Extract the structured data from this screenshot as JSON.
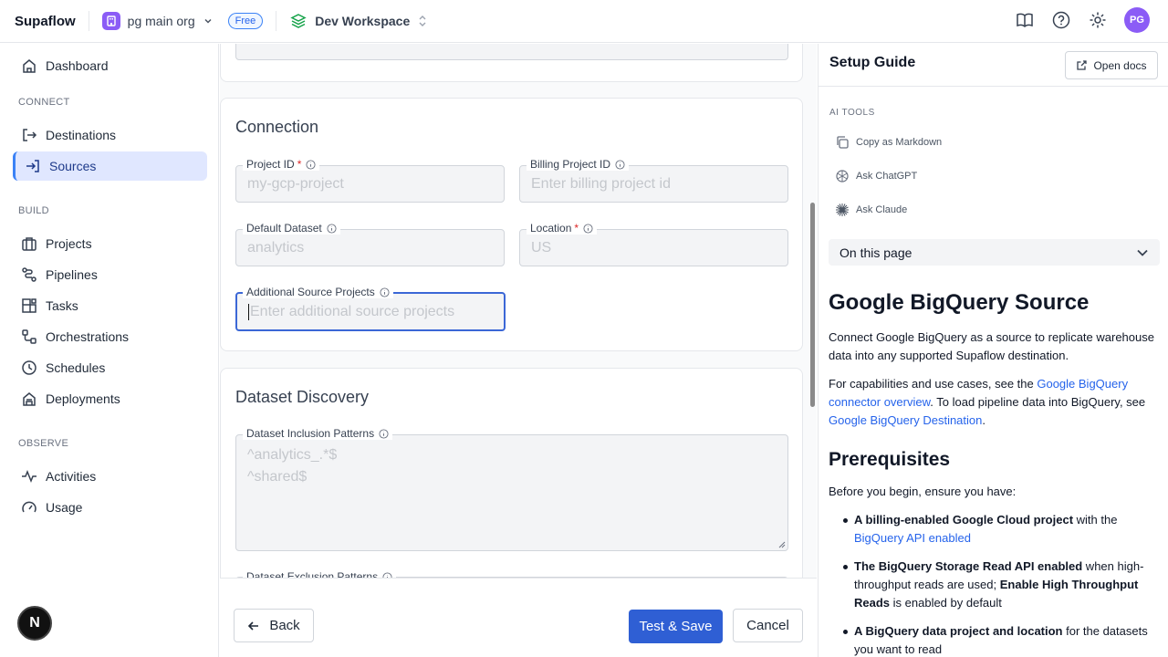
{
  "topbar": {
    "brand": "Supaflow",
    "org_name": "pg main org",
    "plan_badge": "Free",
    "workspace": "Dev Workspace",
    "avatar_initials": "PG"
  },
  "sidebar": {
    "dashboard": "Dashboard",
    "section_connect": "CONNECT",
    "destinations": "Destinations",
    "sources": "Sources",
    "section_build": "BUILD",
    "projects": "Projects",
    "pipelines": "Pipelines",
    "tasks": "Tasks",
    "orchestrations": "Orchestrations",
    "schedules": "Schedules",
    "deployments": "Deployments",
    "section_observe": "OBSERVE",
    "activities": "Activities",
    "usage": "Usage",
    "bottom_avatar": "N"
  },
  "connection": {
    "title": "Connection",
    "project_id_label": "Project ID",
    "project_id_placeholder": "my-gcp-project",
    "billing_label": "Billing Project ID",
    "billing_placeholder": "Enter billing project id",
    "dataset_label": "Default Dataset",
    "dataset_placeholder": "analytics",
    "location_label": "Location",
    "location_placeholder": "US",
    "additional_label": "Additional Source Projects",
    "additional_placeholder": "Enter additional source projects",
    "required_mark": "*"
  },
  "discovery": {
    "title": "Dataset Discovery",
    "inclusion_label": "Dataset Inclusion Patterns",
    "inclusion_line1": "^analytics_.*$",
    "inclusion_line2": "^shared$",
    "exclusion_label": "Dataset Exclusion Patterns"
  },
  "actions": {
    "back": "Back",
    "test_save": "Test & Save",
    "cancel": "Cancel"
  },
  "guide": {
    "title": "Setup Guide",
    "open_docs": "Open docs",
    "ai_tools_label": "AI TOOLS",
    "copy_markdown": "Copy as Markdown",
    "ask_chatgpt": "Ask ChatGPT",
    "ask_claude": "Ask Claude",
    "on_this_page": "On this page",
    "h1": "Google BigQuery Source",
    "intro": "Connect Google BigQuery as a source to replicate warehouse data into any supported Supaflow destination.",
    "p2_a": "For capabilities and use cases, see the ",
    "p2_link1": "Google BigQuery connector overview",
    "p2_b": ". To load pipeline data into BigQuery, see ",
    "p2_link2": "Google BigQuery Destination",
    "p2_c": ".",
    "h2": "Prerequisites",
    "before": "Before you begin, ensure you have:",
    "b1_bold": "A billing-enabled Google Cloud project",
    "b1_text": " with the ",
    "b1_link": "BigQuery API enabled",
    "b2_bold": "The BigQuery Storage Read API enabled",
    "b2_text": " when high-throughput reads are used; ",
    "b2_bold2": "Enable High Throughput Reads",
    "b2_text2": " is enabled by default",
    "b3_bold": "A BigQuery data project and location",
    "b3_text": " for the datasets you want to read"
  }
}
